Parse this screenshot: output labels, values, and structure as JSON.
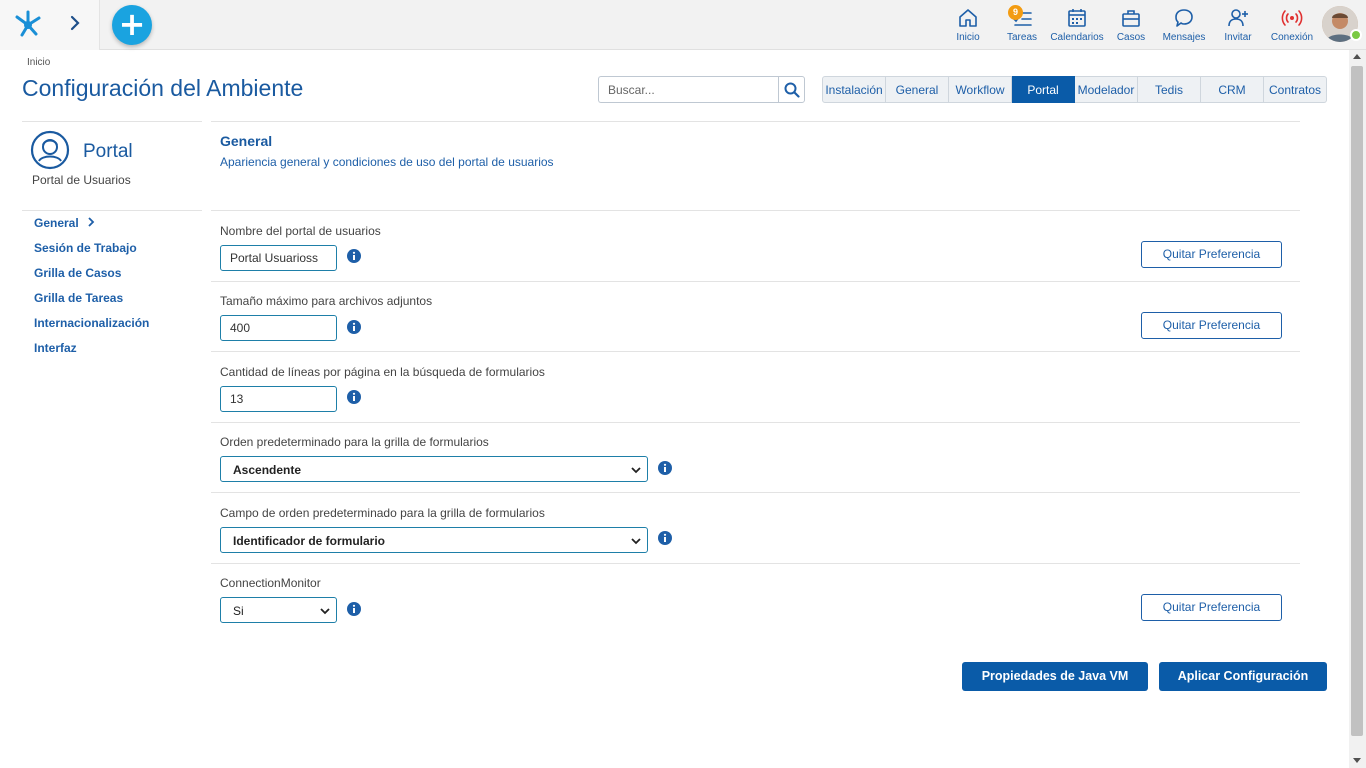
{
  "topbar": {
    "items": [
      {
        "label": "Inicio",
        "icon": "home-icon"
      },
      {
        "label": "Tareas",
        "icon": "tasks-icon",
        "badge": "9"
      },
      {
        "label": "Calendarios",
        "icon": "calendar-icon"
      },
      {
        "label": "Casos",
        "icon": "briefcase-icon"
      },
      {
        "label": "Mensajes",
        "icon": "message-icon"
      },
      {
        "label": "Invitar",
        "icon": "invite-user-icon"
      },
      {
        "label": "Conexión",
        "icon": "connection-icon"
      }
    ],
    "add_label": "+"
  },
  "breadcrumb": "Inicio",
  "page_title": "Configuración del Ambiente",
  "search": {
    "placeholder": "Buscar..."
  },
  "tabs": [
    {
      "label": "Instalación"
    },
    {
      "label": "General"
    },
    {
      "label": "Workflow"
    },
    {
      "label": "Portal",
      "active": true
    },
    {
      "label": "Modelador"
    },
    {
      "label": "Tedis"
    },
    {
      "label": "CRM"
    },
    {
      "label": "Contratos"
    }
  ],
  "left_panel": {
    "title": "Portal",
    "subtitle": "Portal de Usuarios",
    "menu": [
      {
        "label": "General",
        "active": true
      },
      {
        "label": "Sesión de Trabajo"
      },
      {
        "label": "Grilla de Casos"
      },
      {
        "label": "Grilla de Tareas"
      },
      {
        "label": "Internacionalización"
      },
      {
        "label": "Interfaz"
      }
    ]
  },
  "section": {
    "title": "General",
    "subtitle": "Apariencia general y condiciones de uso del portal de usuarios"
  },
  "fields": [
    {
      "label": "Nombre del portal de usuarios",
      "value": "Portal Usuarioss",
      "type": "text",
      "pref_button": "Quitar Preferencia"
    },
    {
      "label": "Tamaño máximo para archivos adjuntos",
      "value": "400",
      "type": "text",
      "pref_button": "Quitar Preferencia"
    },
    {
      "label": "Cantidad de líneas por página en la búsqueda de formularios",
      "value": "13",
      "type": "text"
    },
    {
      "label": "Orden predeterminado para la grilla de formularios",
      "value": "Ascendente",
      "type": "select"
    },
    {
      "label": "Campo de orden predeterminado para la grilla de formularios",
      "value": "Identificador de formulario",
      "type": "select"
    },
    {
      "label": "ConnectionMonitor",
      "value": "Si",
      "type": "select",
      "pref_button": "Quitar Preferencia"
    }
  ],
  "actions": {
    "java_vm": "Propiedades de Java VM",
    "apply": "Aplicar Configuración"
  },
  "colors": {
    "primary": "#0a5ba8",
    "accent": "#1aa3e0",
    "badge": "#f39c12",
    "online": "#7ac943"
  }
}
